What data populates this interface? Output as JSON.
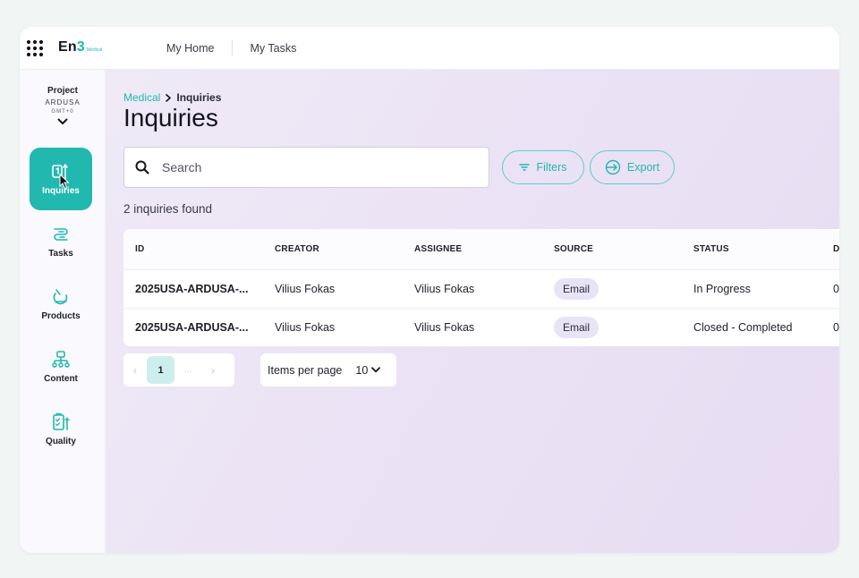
{
  "app": {
    "logo_main": "En",
    "logo_accent": "3",
    "logo_sub": "Medical",
    "accent_color": "#21b8b0"
  },
  "nav": [
    {
      "label": "My Home"
    },
    {
      "label": "My Tasks"
    }
  ],
  "project": {
    "label": "Project",
    "code": "ARDUSA",
    "timezone": "GMT+0"
  },
  "sidebar": {
    "items": [
      {
        "label": "Inquiries",
        "icon": "inquiries-icon",
        "active": true
      },
      {
        "label": "Tasks",
        "icon": "tasks-icon"
      },
      {
        "label": "Products",
        "icon": "products-icon"
      },
      {
        "label": "Content",
        "icon": "content-icon"
      },
      {
        "label": "Quality",
        "icon": "quality-icon"
      }
    ]
  },
  "breadcrumb": {
    "parent": "Medical",
    "current": "Inquiries"
  },
  "page": {
    "title": "Inquiries",
    "search_placeholder": "Search",
    "filters_label": "Filters",
    "export_label": "Export",
    "result_count": "2 inquiries found"
  },
  "table": {
    "columns": [
      "ID",
      "CREATOR",
      "ASSIGNEE",
      "SOURCE",
      "STATUS",
      "D"
    ],
    "rows": [
      {
        "id": "2025USA-ARDUSA-...",
        "creator": "Vilius Fokas",
        "assignee": "Vilius Fokas",
        "source": "Email",
        "status": "In Progress",
        "d": "0"
      },
      {
        "id": "2025USA-ARDUSA-...",
        "creator": "Vilius Fokas",
        "assignee": "Vilius Fokas",
        "source": "Email",
        "status": "Closed - Completed",
        "d": "0"
      }
    ]
  },
  "pagination": {
    "prev": "‹",
    "current_page": "1",
    "ellipsis": "...",
    "next": "›",
    "per_page_label": "Items per page",
    "per_page_value": "10"
  }
}
